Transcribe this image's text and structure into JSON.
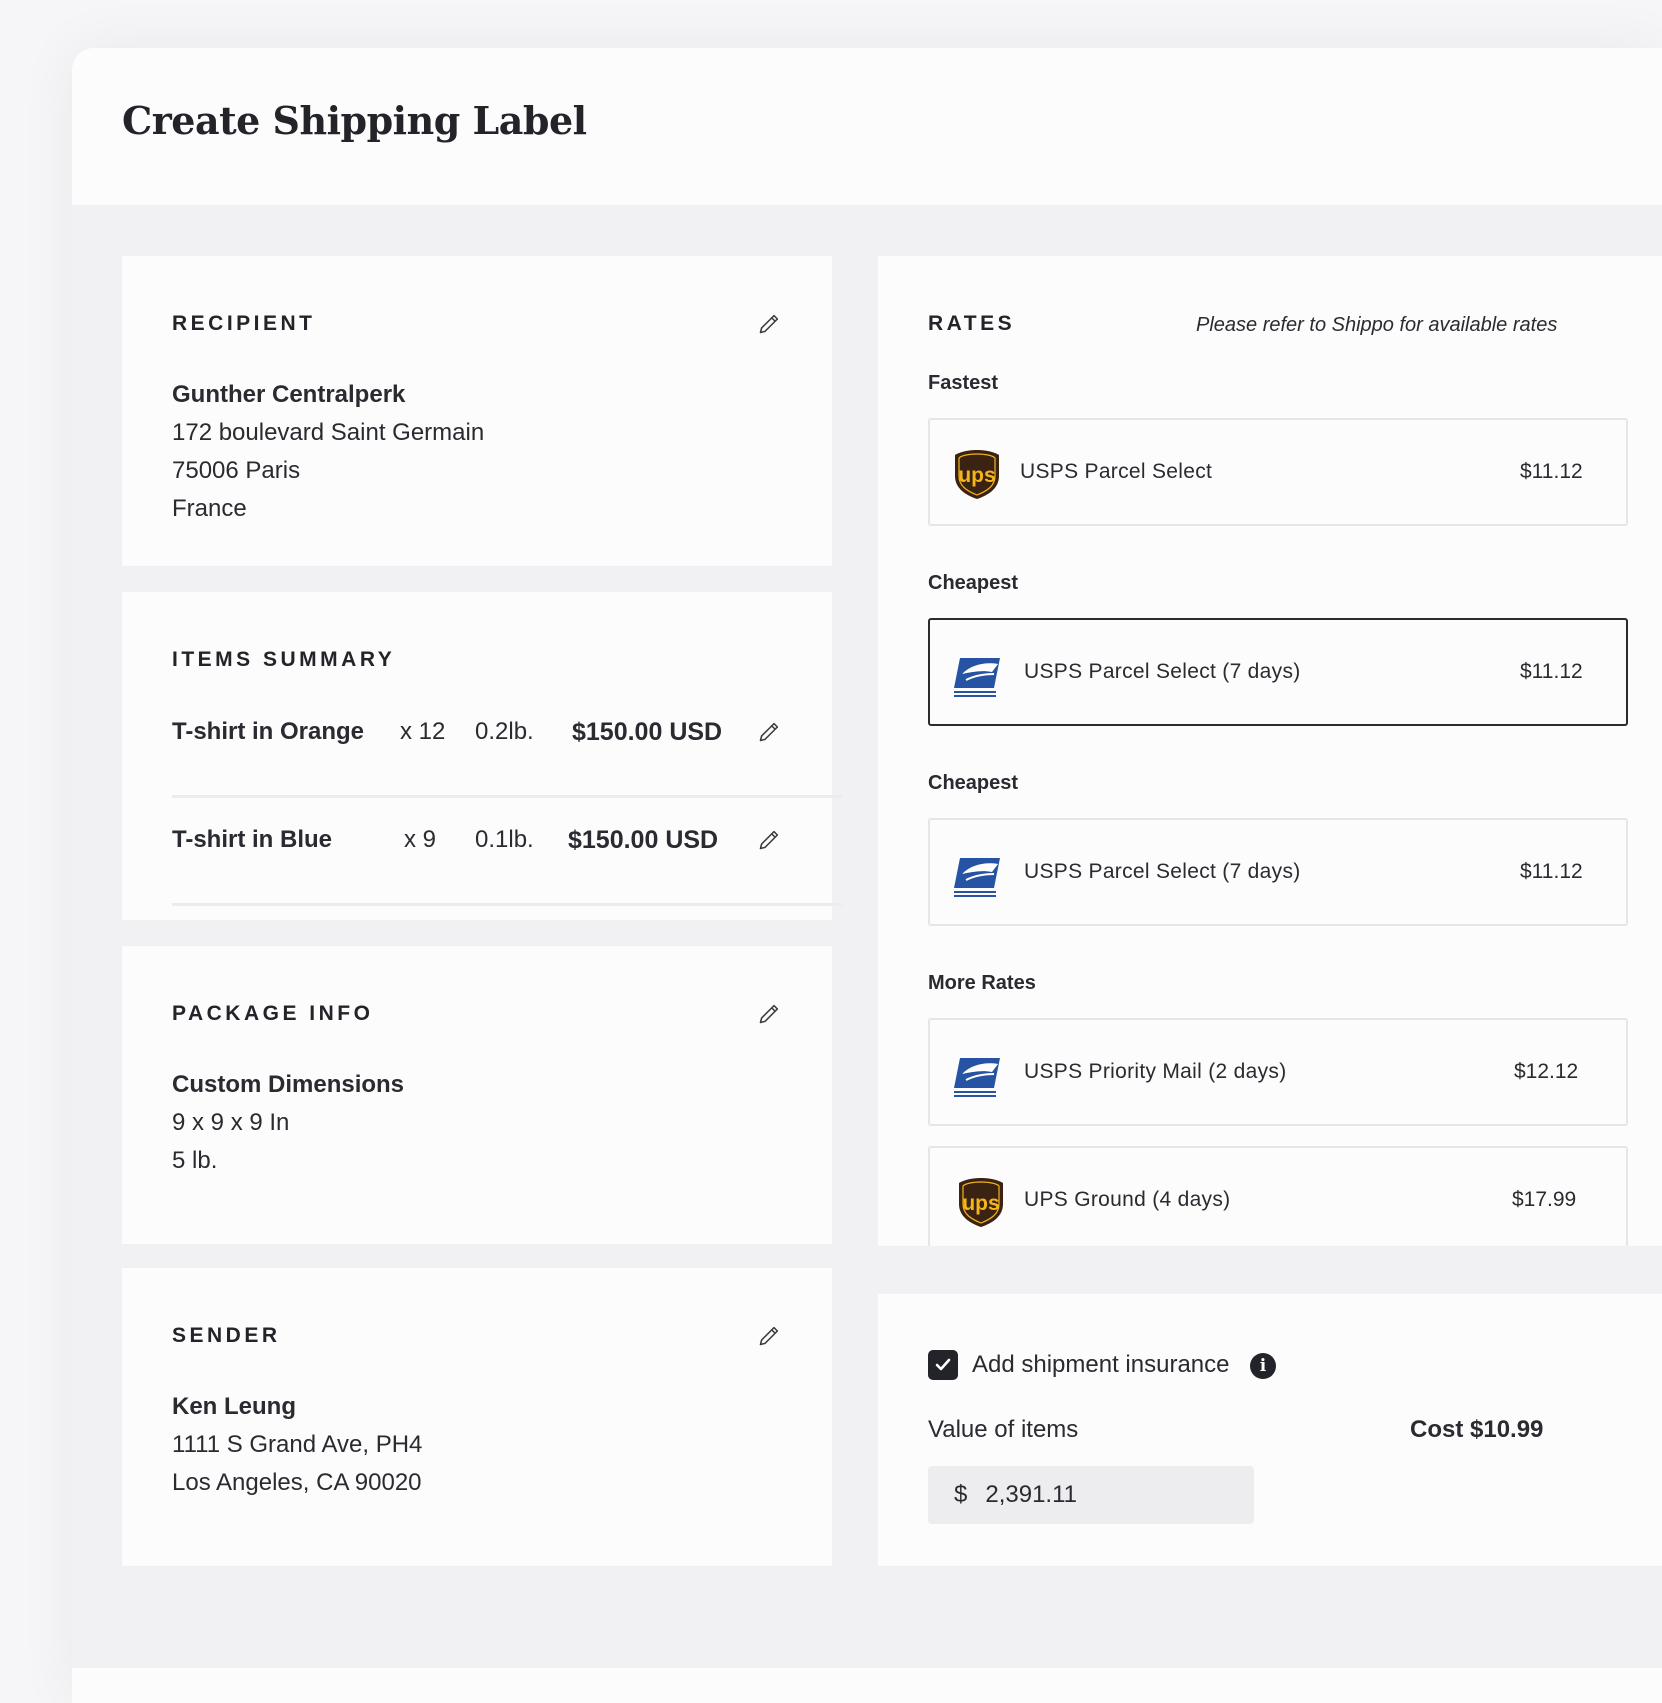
{
  "page": {
    "title": "Create Shipping Label"
  },
  "recipient": {
    "title": "RECIPIENT",
    "name": "Gunther Centralperk",
    "line1": "172 boulevard Saint Germain",
    "line2": "75006 Paris",
    "line3": "France",
    "edit_icon": "pencil-icon"
  },
  "items_summary": {
    "title": "ITEMS SUMMARY",
    "items": [
      {
        "name": "T-shirt in Orange",
        "qty": "x 12",
        "weight": "0.2lb.",
        "price": "$150.00 USD"
      },
      {
        "name": "T-shirt in Blue",
        "qty": "x 9",
        "weight": "0.1lb.",
        "price": "$150.00 USD"
      }
    ]
  },
  "package_info": {
    "title": "PACKAGE INFO",
    "type": "Custom Dimensions",
    "dimensions": "9 x 9 x 9 In",
    "weight": "5 lb."
  },
  "sender": {
    "title": "SENDER",
    "name": "Ken Leung",
    "line1": "1111 S Grand Ave, PH4",
    "line2": "Los Angeles, CA 90020"
  },
  "rates": {
    "title": "RATES",
    "note": "Please refer to Shippo for available rates",
    "groups": [
      {
        "label": "Fastest",
        "carrier_logo": "ups-logo",
        "name": "USPS Parcel Select",
        "price": "$11.12",
        "selected": false
      },
      {
        "label": "Cheapest",
        "carrier_logo": "usps-logo",
        "name": "USPS Parcel Select (7 days)",
        "price": "$11.12",
        "selected": true
      },
      {
        "label": "Cheapest",
        "carrier_logo": "usps-logo",
        "name": "USPS Parcel Select (7 days)",
        "price": "$11.12",
        "selected": false
      }
    ],
    "more_rates": {
      "label": "More Rates",
      "options": [
        {
          "carrier_logo": "usps-logo",
          "name": "USPS Priority Mail (2 days)",
          "price": "$12.12"
        },
        {
          "carrier_logo": "ups-logo",
          "name": "UPS Ground (4 days)",
          "price": "$17.99"
        }
      ]
    }
  },
  "insurance": {
    "checkbox_label": "Add shipment insurance",
    "checked": true,
    "value_label": "Value of items",
    "cost_label": "Cost $10.99",
    "currency": "$",
    "value": "2,391.11"
  },
  "colors": {
    "background": "#f1f1f4",
    "card": "#fcfcfd",
    "text": "#23232a",
    "ups_brown": "#3b2314",
    "ups_gold": "#f4b41a",
    "usps_blue": "#2653a3"
  }
}
